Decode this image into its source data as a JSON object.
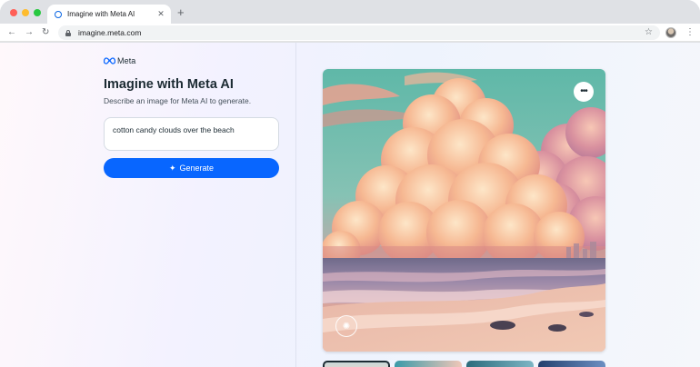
{
  "browser": {
    "tab_title": "Imagine with Meta AI",
    "tab_close": "✕",
    "new_tab": "+",
    "url": "imagine.meta.com",
    "nav_back": "←",
    "nav_forward": "→",
    "nav_reload": "↻",
    "bookmark": "☆",
    "menu": "⋮"
  },
  "page": {
    "brand": "Meta",
    "title": "Imagine with Meta AI",
    "subtitle": "Describe an image for Meta AI to generate.",
    "prompt": "cotton candy clouds over the beach",
    "generate_label": "Generate",
    "more_label": "•••"
  },
  "colors": {
    "accent": "#0866ff",
    "text": "#1c2b33"
  },
  "icons": {
    "lock": "lock-icon",
    "sparkle": "sparkle-icon",
    "more": "more-icon",
    "badge": "imagine-badge-icon"
  }
}
